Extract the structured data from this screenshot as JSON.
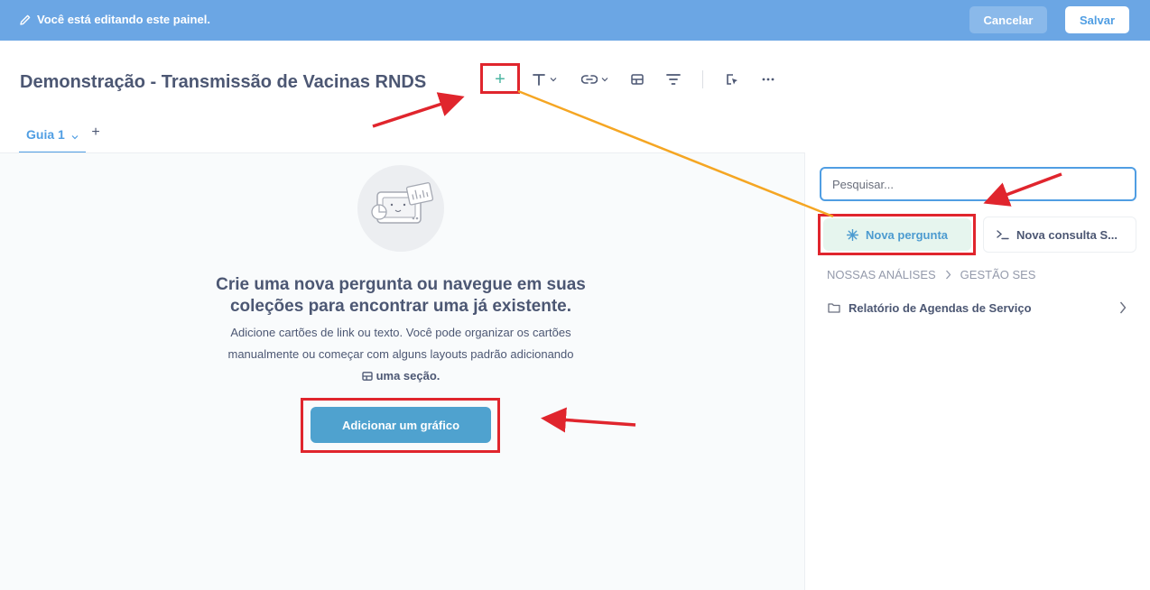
{
  "edit_bar": {
    "message": "Você está editando este painel.",
    "cancel_label": "Cancelar",
    "save_label": "Salvar"
  },
  "header": {
    "title": "Demonstração - Transmissão de Vacinas RNDS",
    "toolbar": {
      "add": "+"
    }
  },
  "tabs": [
    {
      "label": "Guia 1"
    }
  ],
  "tab_add": "+",
  "empty_state": {
    "title": "Crie uma nova pergunta ou navegue em suas coleções para encontrar uma já existente.",
    "description": "Adicione cartões de link ou texto. Você pode organizar os cartões manualmente ou começar com alguns layouts padrão adicionando",
    "section_link": "uma seção.",
    "button_label": "Adicionar um gráfico"
  },
  "sidebar": {
    "search_placeholder": "Pesquisar...",
    "new_question": "Nova pergunta",
    "new_sql": "Nova consulta S...",
    "breadcrumb": [
      "NOSSAS ANÁLISES",
      "GESTÃO SES"
    ],
    "items": [
      {
        "label": "Relatório de Agendas de Serviço"
      }
    ]
  },
  "colors": {
    "brand": "#509ee3",
    "annotation_red": "#e0252d",
    "annotation_orange": "#f5a623",
    "accent_green": "#4cb5a2"
  }
}
